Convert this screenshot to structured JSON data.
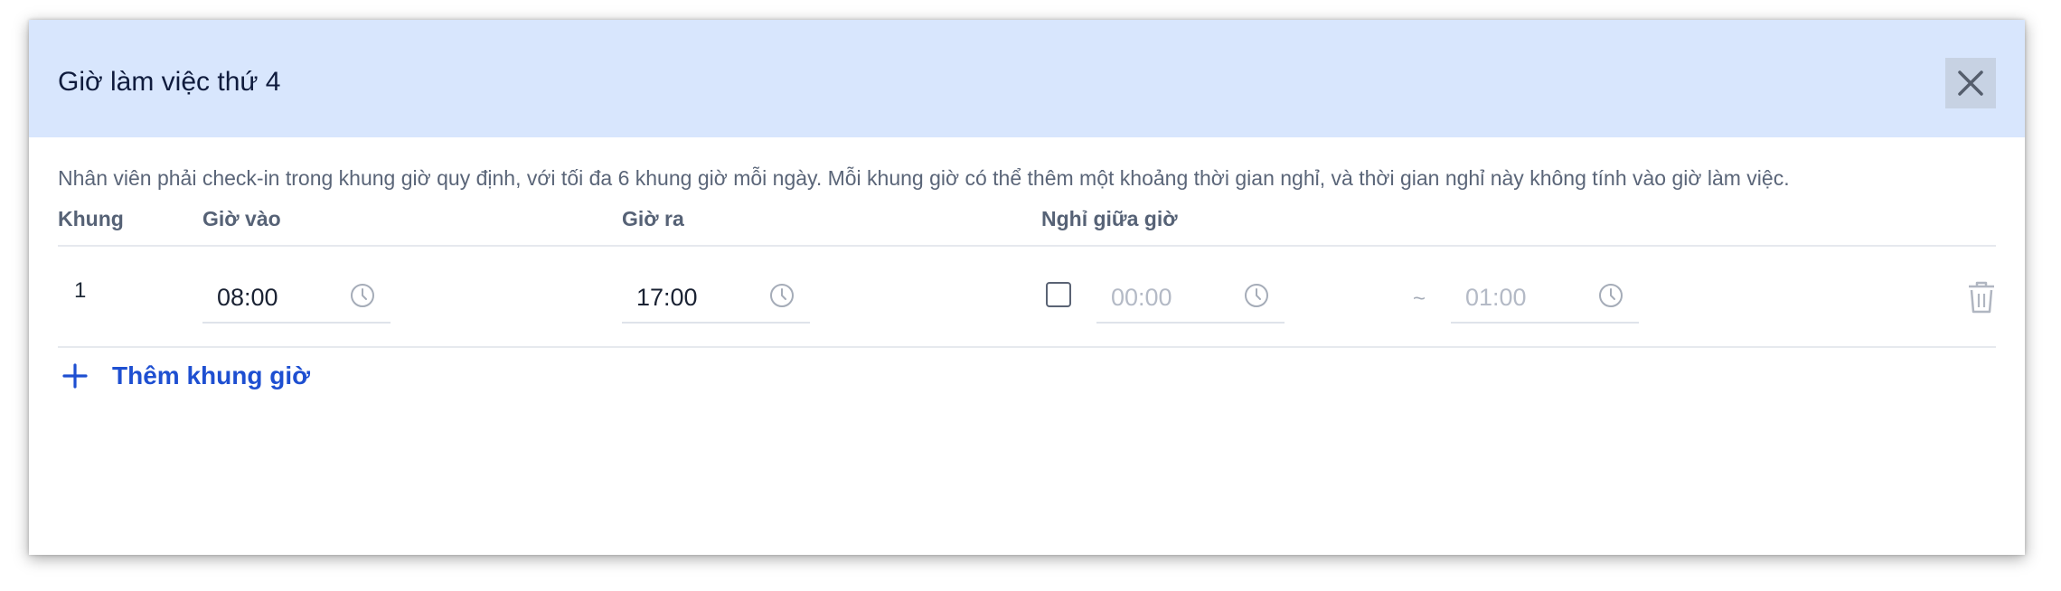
{
  "dialog": {
    "title": "Giờ làm việc thứ 4",
    "close_icon": "close-icon",
    "description": "Nhân viên phải check-in trong khung giờ quy định, với tối đa 6 khung giờ mỗi ngày. Mỗi khung giờ có thể thêm một khoảng thời gian nghỉ, và thời gian nghỉ này không tính vào giờ làm việc."
  },
  "table": {
    "headers": {
      "frame": "Khung",
      "check_in": "Giờ vào",
      "check_out": "Giờ ra",
      "break": "Nghỉ giữa giờ"
    },
    "rows": [
      {
        "index": "1",
        "check_in": "08:00",
        "check_out": "17:00",
        "break_enabled": false,
        "break_start": "00:00",
        "break_separator": "~",
        "break_end": "01:00"
      }
    ]
  },
  "actions": {
    "add_frame_label": "Thêm khung giờ",
    "add_icon": "plus-icon",
    "delete_icon": "trash-icon"
  },
  "colors": {
    "header_bg": "#d8e6fd",
    "accent": "#1e4fd1",
    "close_bg": "#c7d2e3"
  }
}
